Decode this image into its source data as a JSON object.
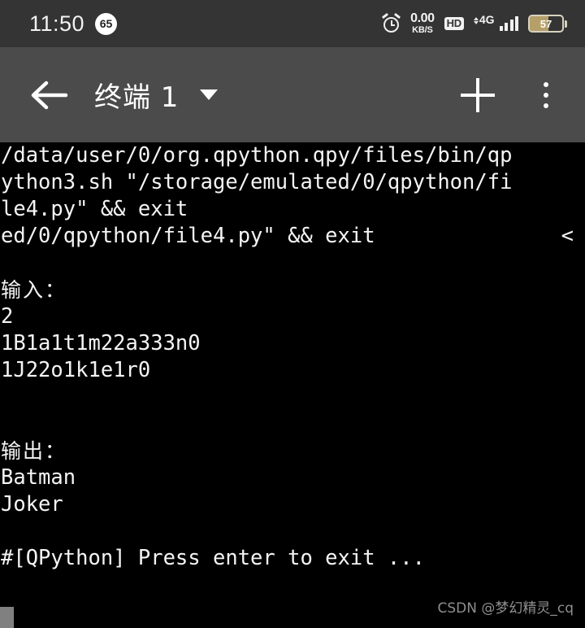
{
  "statusbar": {
    "time": "11:50",
    "notification_count": "65",
    "alarm_icon": "alarm-clock-icon",
    "net_speed_value": "0.00",
    "net_speed_unit": "KB/S",
    "hd_label": "HD",
    "network_type": "4G",
    "signal_bars": 4,
    "battery_level": "57",
    "battery_fill_color": "#b5a069",
    "statusbar_bg": "#343434"
  },
  "toolbar": {
    "back_icon": "arrow-left-icon",
    "title": "终端 1",
    "dropdown_icon": "caret-down-icon",
    "add_icon": "plus-icon",
    "overflow_icon": "more-vertical-icon",
    "toolbar_bg": "#4b4b4b"
  },
  "terminal": {
    "bg": "#000000",
    "fg": "#f4f4f4",
    "lines": [
      {
        "text": "/data/user/0/org.qpython.qpy/files/bin/qp",
        "cjk": false
      },
      {
        "text": "ython3.sh \"/storage/emulated/0/qpython/fi",
        "cjk": false
      },
      {
        "text": "le4.py\" && exit",
        "cjk": false
      },
      {
        "text": "ed/0/qpython/file4.py\" && exit",
        "tail": "<",
        "cjk": false
      },
      {
        "text": "",
        "cjk": false
      },
      {
        "text": "输入：",
        "cjk": true
      },
      {
        "text": "2",
        "cjk": false
      },
      {
        "text": "1B1a1t1m22a333n0",
        "cjk": false
      },
      {
        "text": "1J22o1k1e1r0",
        "cjk": false
      },
      {
        "text": "",
        "cjk": false
      },
      {
        "text": "",
        "cjk": false
      },
      {
        "text": "输出：",
        "cjk": true
      },
      {
        "text": "Batman",
        "cjk": false
      },
      {
        "text": "Joker",
        "cjk": false
      },
      {
        "text": "",
        "cjk": false
      },
      {
        "text": "#[QPython] Press enter to exit ...",
        "cjk": false
      }
    ]
  },
  "watermark": {
    "text": "CSDN @梦幻精灵_cq",
    "color": "#8f8f8f"
  }
}
